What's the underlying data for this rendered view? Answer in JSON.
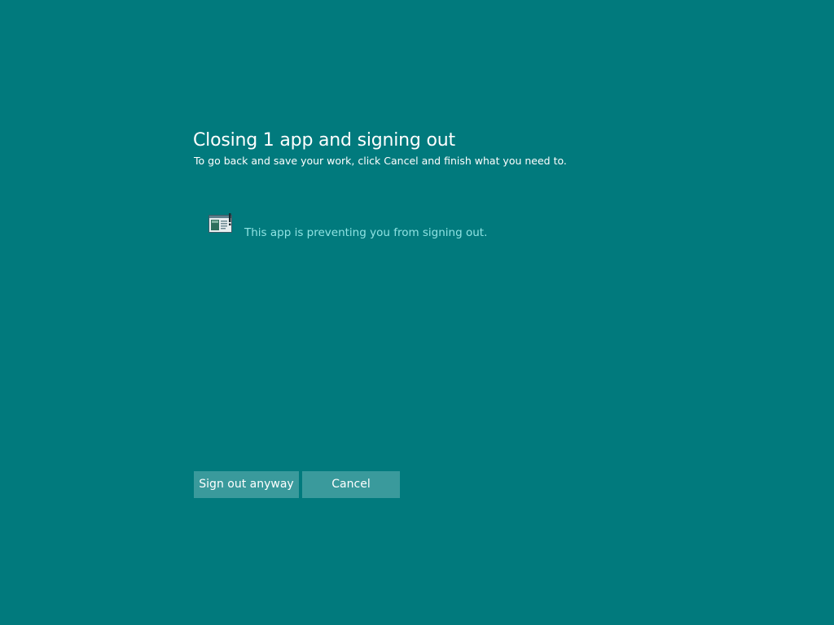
{
  "dialog": {
    "title": "Closing 1 app and signing out",
    "subtitle": "To go back and save your work, click Cancel and finish what you need to."
  },
  "apps": [
    {
      "icon": "application-window-icon",
      "message": "This app is preventing you from signing out."
    }
  ],
  "buttons": {
    "sign_out_label": "Sign out anyway",
    "cancel_label": "Cancel"
  },
  "colors": {
    "background": "#017a7d",
    "button": "#3a9a9c",
    "message_text": "#8fe3e3",
    "text": "#ffffff"
  }
}
